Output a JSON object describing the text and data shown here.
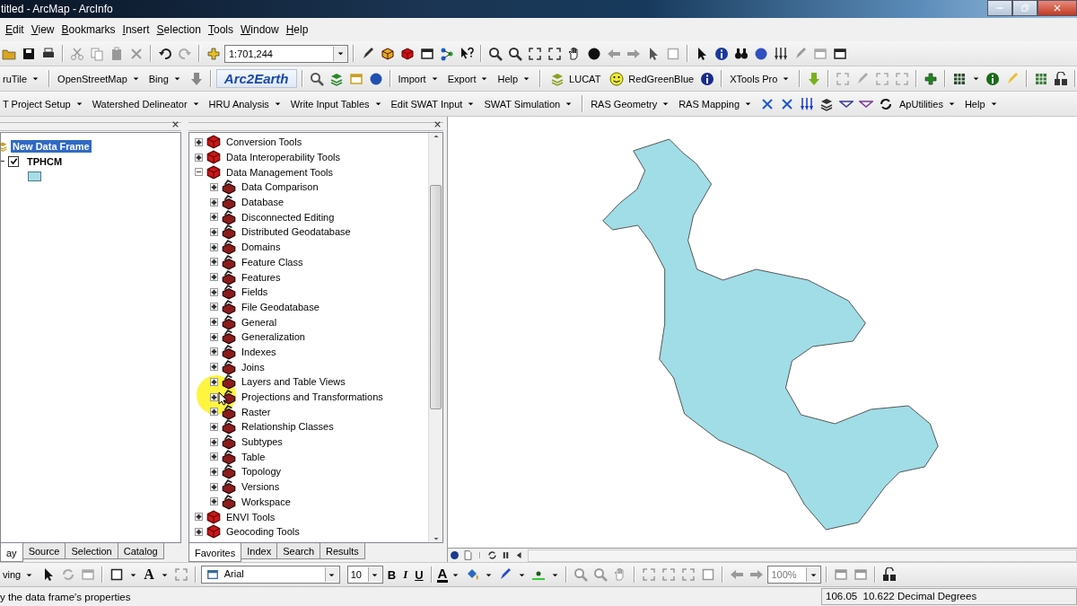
{
  "window": {
    "title": "titled - ArcMap - ArcInfo"
  },
  "menu": [
    "Edit",
    "View",
    "Bookmarks",
    "Insert",
    "Selection",
    "Tools",
    "Window",
    "Help"
  ],
  "standard_toolbar": {
    "scale": "1:701,244"
  },
  "web_toolbar": [
    {
      "kind": "dropdown",
      "label": "ruTile"
    },
    {
      "kind": "dropdown",
      "label": "OpenStreetMap"
    },
    {
      "kind": "dropdown",
      "label": "Bing"
    },
    {
      "kind": "logo",
      "label": "Arc2Earth"
    },
    {
      "kind": "dropdown",
      "label": "Import"
    },
    {
      "kind": "dropdown",
      "label": "Export"
    },
    {
      "kind": "dropdown",
      "label": "Help"
    },
    {
      "kind": "label",
      "label": "LUCAT"
    },
    {
      "kind": "label",
      "label": "RedGreenBlue"
    },
    {
      "kind": "dropdown",
      "label": "XTools Pro"
    }
  ],
  "swat_toolbar": [
    "T Project Setup",
    "Watershed Delineator",
    "HRU Analysis",
    "Write Input Tables",
    "Edit SWAT Input",
    "SWAT Simulation",
    "RAS Geometry",
    "RAS Mapping",
    "ApUtilities",
    "Help"
  ],
  "table_of_contents": {
    "data_frame": {
      "label": "New Data Frame",
      "selected": true
    },
    "layers": [
      {
        "label": "TPHCM",
        "checked": true,
        "expanded": true
      }
    ]
  },
  "toc_tabs": [
    {
      "label": "ay",
      "selected": true
    },
    {
      "label": "Source",
      "selected": false
    },
    {
      "label": "Selection",
      "selected": false
    },
    {
      "label": "Catalog",
      "selected": false
    }
  ],
  "toolbox_tree": [
    {
      "label": "Conversion Tools",
      "expanded": false
    },
    {
      "label": "Data Interoperability Tools",
      "expanded": false
    },
    {
      "label": "Data Management Tools",
      "expanded": true,
      "children": [
        {
          "label": "Data Comparison",
          "expanded": false
        },
        {
          "label": "Database",
          "expanded": false
        },
        {
          "label": "Disconnected Editing",
          "expanded": false
        },
        {
          "label": "Distributed Geodatabase",
          "expanded": false
        },
        {
          "label": "Domains",
          "expanded": false
        },
        {
          "label": "Feature Class",
          "expanded": false
        },
        {
          "label": "Features",
          "expanded": false
        },
        {
          "label": "Fields",
          "expanded": false
        },
        {
          "label": "File Geodatabase",
          "expanded": false
        },
        {
          "label": "General",
          "expanded": false
        },
        {
          "label": "Generalization",
          "expanded": false
        },
        {
          "label": "Indexes",
          "expanded": false
        },
        {
          "label": "Joins",
          "expanded": false
        },
        {
          "label": "Layers and Table Views",
          "expanded": false
        },
        {
          "label": "Projections and Transformations",
          "expanded": false
        },
        {
          "label": "Raster",
          "expanded": false
        },
        {
          "label": "Relationship Classes",
          "expanded": false
        },
        {
          "label": "Subtypes",
          "expanded": false
        },
        {
          "label": "Table",
          "expanded": false
        },
        {
          "label": "Topology",
          "expanded": false
        },
        {
          "label": "Versions",
          "expanded": false
        },
        {
          "label": "Workspace",
          "expanded": false
        }
      ]
    },
    {
      "label": "ENVI Tools",
      "expanded": false
    },
    {
      "label": "Geocoding Tools",
      "expanded": false
    }
  ],
  "toolbox_tabs": [
    {
      "label": "Favorites",
      "selected": true
    },
    {
      "label": "Index",
      "selected": false
    },
    {
      "label": "Search",
      "selected": false
    },
    {
      "label": "Results",
      "selected": false
    }
  ],
  "drawing_toolbar": {
    "drawing_menu": "ving",
    "text_tool": "A",
    "font": "Arial",
    "font_size": "10",
    "bold": "B",
    "italic": "I",
    "underline": "U",
    "font_color": "A",
    "zoom": "100%"
  },
  "status_bar": {
    "message": "y the data frame's properties",
    "coordinates": "106.05  10.622 Decimal Degrees"
  }
}
